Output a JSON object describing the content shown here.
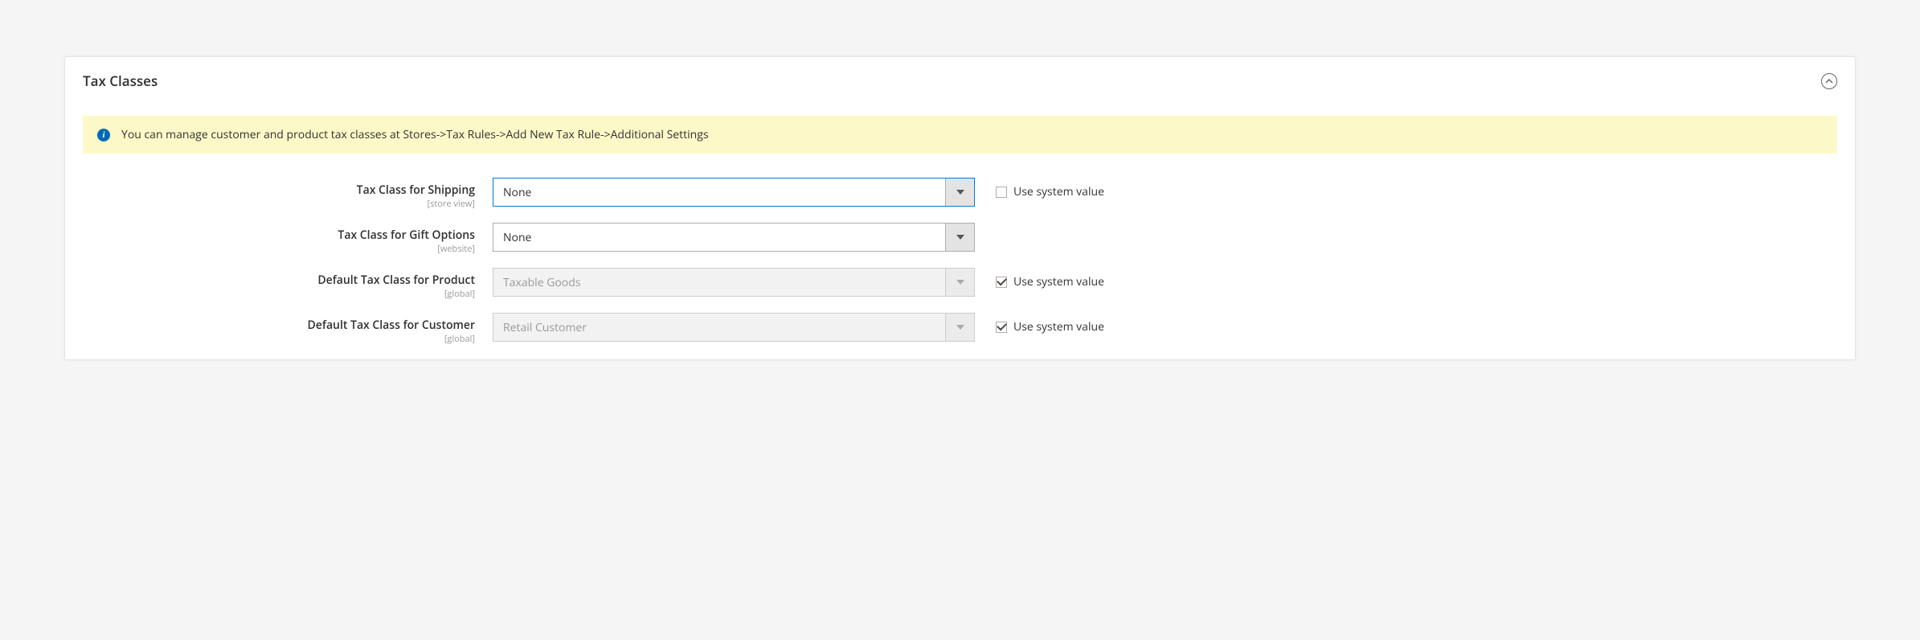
{
  "section": {
    "title": "Tax Classes"
  },
  "notice": {
    "text": "You can manage customer and product tax classes at Stores->Tax Rules->Add New Tax Rule->Additional Settings"
  },
  "fields": {
    "shipping": {
      "label": "Tax Class for Shipping",
      "scope": "[store view]",
      "value": "None",
      "system_label": "Use system value"
    },
    "gift": {
      "label": "Tax Class for Gift Options",
      "scope": "[website]",
      "value": "None"
    },
    "product": {
      "label": "Default Tax Class for Product",
      "scope": "[global]",
      "value": "Taxable Goods",
      "system_label": "Use system value"
    },
    "customer": {
      "label": "Default Tax Class for Customer",
      "scope": "[global]",
      "value": "Retail Customer",
      "system_label": "Use system value"
    }
  }
}
